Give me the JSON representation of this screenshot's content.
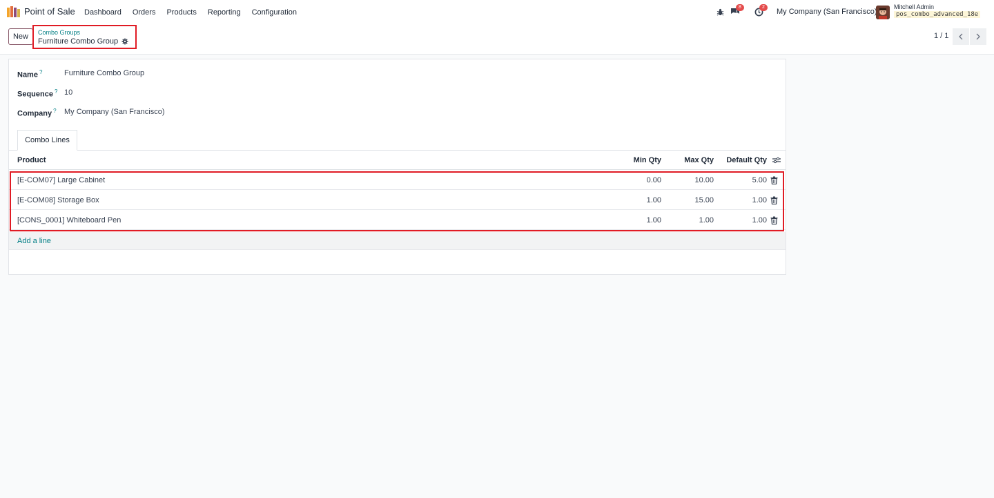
{
  "navbar": {
    "app_name": "Point of Sale",
    "menu": [
      "Dashboard",
      "Orders",
      "Products",
      "Reporting",
      "Configuration"
    ],
    "messages_count": "8",
    "activities_count": "2",
    "company": "My Company (San Francisco)",
    "user_name": "Mitchell Admin",
    "db_name": "pos_combo_advanced_18e"
  },
  "control_panel": {
    "new_label": "New",
    "breadcrumb_parent": "Combo Groups",
    "breadcrumb_current": "Furniture Combo Group",
    "pager": "1 / 1"
  },
  "form": {
    "fields": [
      {
        "label": "Name",
        "help": "?",
        "value": "Furniture Combo Group"
      },
      {
        "label": "Sequence",
        "help": "?",
        "value": "10"
      },
      {
        "label": "Company",
        "help": "?",
        "value": "My Company (San Francisco)"
      }
    ],
    "tab_label": "Combo Lines",
    "columns": {
      "product": "Product",
      "min_qty": "Min Qty",
      "max_qty": "Max Qty",
      "default_qty": "Default Qty"
    },
    "lines": [
      {
        "product": "[E-COM07] Large Cabinet",
        "min_qty": "0.00",
        "max_qty": "10.00",
        "default_qty": "5.00"
      },
      {
        "product": "[E-COM08] Storage Box",
        "min_qty": "1.00",
        "max_qty": "15.00",
        "default_qty": "1.00"
      },
      {
        "product": "[CONS_0001] Whiteboard Pen",
        "min_qty": "1.00",
        "max_qty": "1.00",
        "default_qty": "1.00"
      }
    ],
    "add_line": "Add a line"
  },
  "colors": {
    "accent": "#017e84",
    "highlight": "#e01b24",
    "badge": "#e44c4c"
  }
}
